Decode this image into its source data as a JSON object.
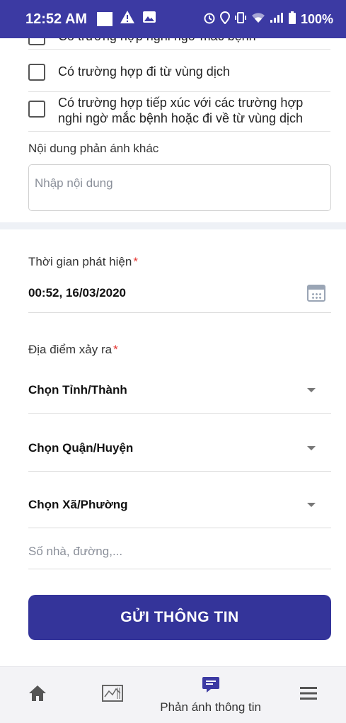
{
  "status_bar": {
    "time": "12:52 AM",
    "battery": "100%"
  },
  "checklist": [
    {
      "label": "Có trường hợp nghi ngờ mắc bệnh",
      "checked": false
    },
    {
      "label": "Có trường hợp đi từ vùng dịch",
      "checked": false
    },
    {
      "label": "Có trường hợp tiếp xúc với các trường hợp nghi ngờ mắc bệnh hoặc đi về từ vùng dịch",
      "checked": false
    }
  ],
  "other_report": {
    "label": "Nội dung phản ánh khác",
    "placeholder": "Nhập nội dung"
  },
  "detection_time": {
    "label": "Thời gian phát hiện",
    "required_mark": "*",
    "value": "00:52, 16/03/2020"
  },
  "location": {
    "label": "Địa điểm xảy ra",
    "required_mark": "*",
    "province": "Chọn Tỉnh/Thành",
    "district": "Chọn Quận/Huyện",
    "ward": "Chọn Xã/Phường",
    "address_placeholder": "Số nhà, đường,..."
  },
  "submit_label": "GỬI THÔNG TIN",
  "bottom_nav": {
    "active_label": "Phản ánh thông tin"
  },
  "colors": {
    "primary": "#34349a",
    "status_bar": "#3c3aa3",
    "required": "#e53935"
  }
}
